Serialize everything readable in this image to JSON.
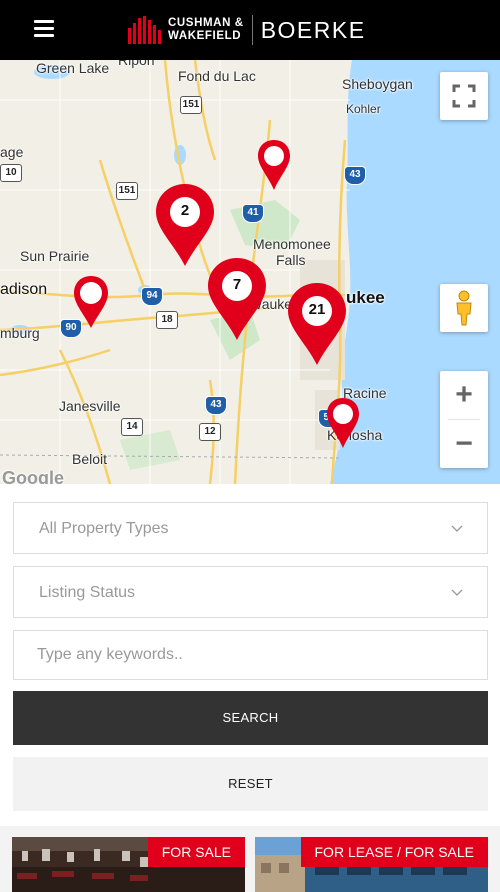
{
  "header": {
    "brand_line1": "CUSHMAN &",
    "brand_line2": "WAKEFIELD",
    "brand_partner": "BOERKE"
  },
  "map": {
    "places": [
      {
        "name": "Green Lake"
      },
      {
        "name": "Ripon"
      },
      {
        "name": "Fond du Lac"
      },
      {
        "name": "Sheboygan"
      },
      {
        "name": "Kohler"
      },
      {
        "name": "age"
      },
      {
        "name": "Sun Prairie"
      },
      {
        "name": "Menomonee"
      },
      {
        "name": "Falls"
      },
      {
        "name": "adison"
      },
      {
        "name": "ukee"
      },
      {
        "name": "Waukesha"
      },
      {
        "name": "mburg"
      },
      {
        "name": "Janesville"
      },
      {
        "name": "Racine"
      },
      {
        "name": "Kenosha"
      },
      {
        "name": "Beloit"
      },
      {
        "name": "Google"
      }
    ],
    "highways": [
      "151",
      "10",
      "151",
      "41",
      "43",
      "94",
      "18",
      "90",
      "14",
      "43",
      "12",
      "51"
    ],
    "pins": [
      {
        "count": "2"
      },
      {
        "count": "7"
      },
      {
        "count": "21"
      }
    ],
    "controls": {
      "fullscreen_icon": "fullscreen-icon",
      "pegman_icon": "pegman-icon",
      "zoom_in": "+",
      "zoom_out": "−"
    },
    "colors": {
      "water": "#aadaff",
      "land": "#f1efe6",
      "pin": "#e0001b",
      "road": "#f6cf65"
    }
  },
  "search": {
    "property_types_placeholder": "All Property Types",
    "listing_status_placeholder": "Listing Status",
    "keywords_placeholder": "Type any keywords..",
    "search_label": "SEARCH",
    "reset_label": "RESET"
  },
  "listings": [
    {
      "badge": "FOR SALE"
    },
    {
      "badge": "FOR LEASE / FOR SALE"
    }
  ]
}
